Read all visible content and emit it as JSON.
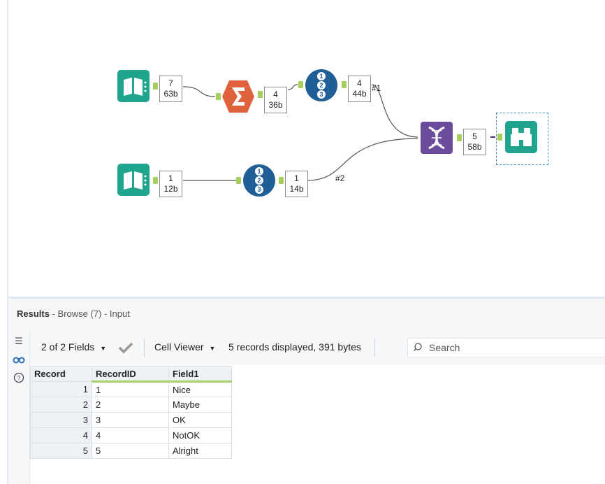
{
  "canvas": {
    "count_boxes": [
      {
        "records": "7",
        "size": "63b"
      },
      {
        "records": "4",
        "size": "36b"
      },
      {
        "records": "4",
        "size": "44b"
      },
      {
        "records": "5",
        "size": "58b"
      },
      {
        "records": "1",
        "size": "12b"
      },
      {
        "records": "1",
        "size": "14b"
      }
    ],
    "connection_labels": [
      "#1",
      "#2"
    ],
    "colors": {
      "input_tool": "#1fa48d",
      "summarize_tool": "#e0623c",
      "record_id_tool": "#1f5e96",
      "union_tool": "#6b4c9a",
      "browse_tool": "#1fa48d",
      "anchor": "#a7cf5b"
    }
  },
  "results": {
    "title": "Results",
    "subtitle": " - Browse (7) - Input"
  },
  "toolbar": {
    "fields_label": "2 of 2 Fields",
    "cell_viewer_label": "Cell Viewer",
    "records_info": "5 records displayed, 391 bytes",
    "search_placeholder": "Search"
  },
  "table": {
    "headers": [
      "Record",
      "RecordID",
      "Field1"
    ],
    "rows": [
      [
        "1",
        "1",
        "Nice"
      ],
      [
        "2",
        "2",
        "Maybe"
      ],
      [
        "3",
        "3",
        "OK"
      ],
      [
        "4",
        "4",
        "NotOK"
      ],
      [
        "5",
        "5",
        "Alright"
      ]
    ]
  }
}
